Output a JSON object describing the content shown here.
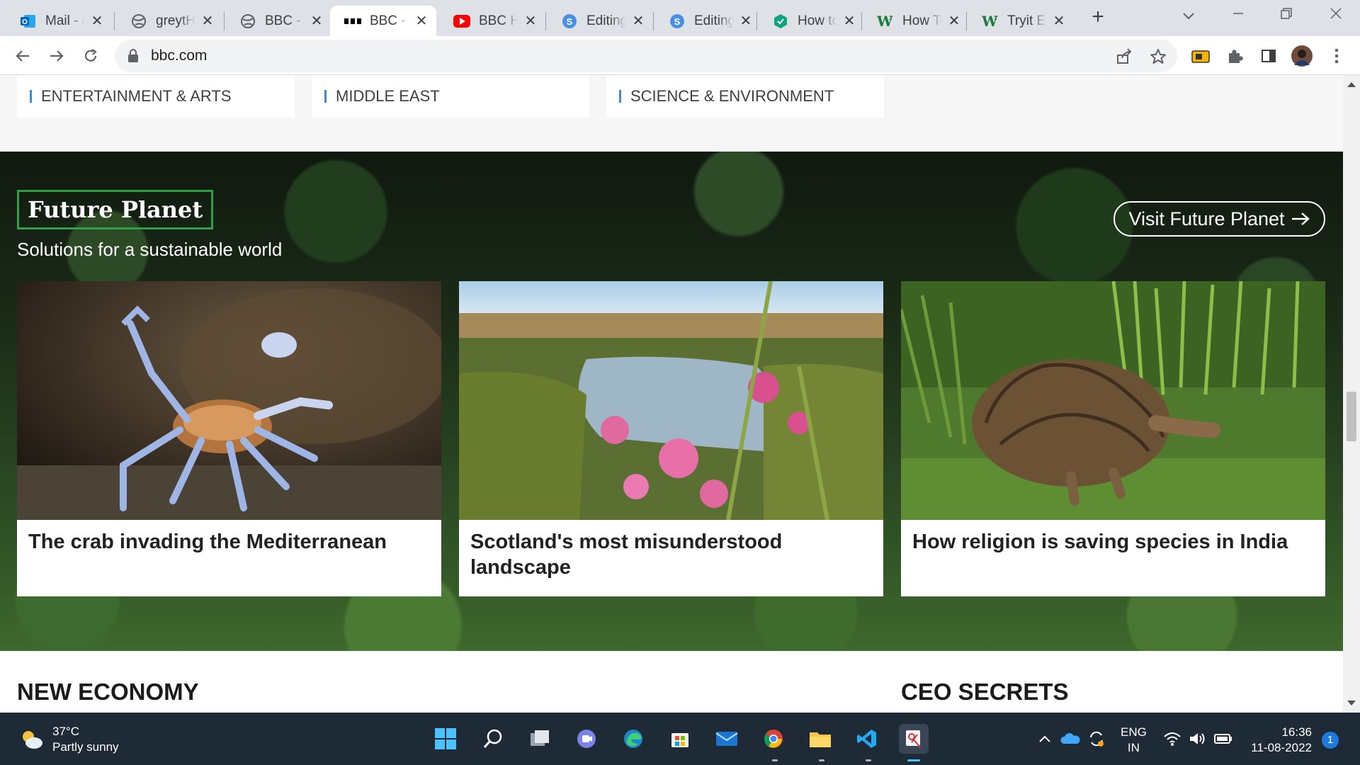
{
  "browser": {
    "tabs": [
      {
        "title": "Mail - /",
        "icon": "outlook-icon",
        "active": false
      },
      {
        "title": "greytH",
        "icon": "globe-icon",
        "active": false
      },
      {
        "title": "BBC - I",
        "icon": "globe-icon",
        "active": false
      },
      {
        "title": "BBC - I",
        "icon": "bbc-icon",
        "active": true
      },
      {
        "title": "BBC H",
        "icon": "youtube-icon",
        "active": false
      },
      {
        "title": "Editing",
        "icon": "editor-icon",
        "active": false
      },
      {
        "title": "Editing",
        "icon": "editor-icon",
        "active": false
      },
      {
        "title": "How to",
        "icon": "hexagon-icon",
        "active": false
      },
      {
        "title": "How To",
        "icon": "wikihow-icon",
        "active": false
      },
      {
        "title": "Tryit Ec",
        "icon": "wikihow-icon",
        "active": false
      }
    ],
    "address": "bbc.com"
  },
  "topics": [
    "ENTERTAINMENT & ARTS",
    "MIDDLE EAST",
    "SCIENCE & ENVIRONMENT"
  ],
  "future_planet": {
    "logo": "Future Planet",
    "subtitle": "Solutions for a sustainable world",
    "visit_label": "Visit Future Planet",
    "cards": [
      {
        "title": "The crab invading the Mediterranean"
      },
      {
        "title": "Scotland's most misunderstood landscape"
      },
      {
        "title": "How religion is saving species in India"
      }
    ]
  },
  "sections": {
    "left": "NEW ECONOMY",
    "right": "CEO SECRETS"
  },
  "taskbar": {
    "weather_temp": "37°C",
    "weather_desc": "Partly sunny",
    "lang_line1": "ENG",
    "lang_line2": "IN",
    "time": "16:36",
    "date": "11-08-2022",
    "notifications": "1"
  },
  "colors": {
    "accent_blue": "#3d8bca",
    "fp_green": "#2e9e48",
    "taskbar": "#1f2a37"
  }
}
